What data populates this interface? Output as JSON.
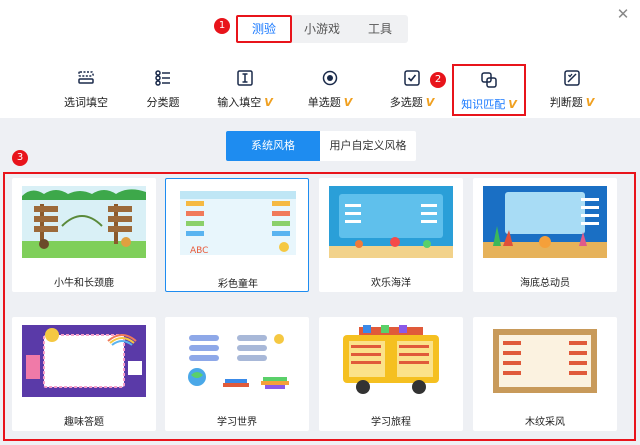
{
  "window": {
    "close_glyph": "✕"
  },
  "top_tabs": [
    {
      "label": "测验",
      "active": true
    },
    {
      "label": "小游戏",
      "active": false
    },
    {
      "label": "工具",
      "active": false
    }
  ],
  "badges": [
    "1",
    "2",
    "3"
  ],
  "question_types": [
    {
      "label": "选词填空",
      "vip": "",
      "icon": "dashed-box-icon"
    },
    {
      "label": "分类题",
      "vip": "",
      "icon": "list-icon"
    },
    {
      "label": "输入填空",
      "vip": "V",
      "icon": "text-cursor-icon"
    },
    {
      "label": "单选题",
      "vip": "V",
      "icon": "radio-icon"
    },
    {
      "label": "多选题",
      "vip": "V",
      "icon": "checkbox-icon"
    },
    {
      "label": "知识匹配",
      "vip": "V",
      "icon": "match-icon",
      "active": true
    },
    {
      "label": "判断题",
      "vip": "V",
      "icon": "judge-icon"
    }
  ],
  "style_tabs": [
    {
      "label": "系统风格",
      "active": true
    },
    {
      "label": "用户自定义风格",
      "active": false
    }
  ],
  "templates": [
    {
      "name": "小牛和长颈鹿",
      "theme": "jungle"
    },
    {
      "name": "彩色童年",
      "theme": "colorful",
      "selected": true
    },
    {
      "name": "欢乐海洋",
      "theme": "ocean"
    },
    {
      "name": "海底总动员",
      "theme": "reef"
    },
    {
      "name": "趣味答题",
      "theme": "fun"
    },
    {
      "name": "学习世界",
      "theme": "world"
    },
    {
      "name": "学习旅程",
      "theme": "bus"
    },
    {
      "name": "木纹采风",
      "theme": "wood"
    }
  ],
  "colors": {
    "accent": "#1677ff",
    "highlight": "#e8141b",
    "vip": "#f0a020",
    "panel": "#eef0f4"
  }
}
